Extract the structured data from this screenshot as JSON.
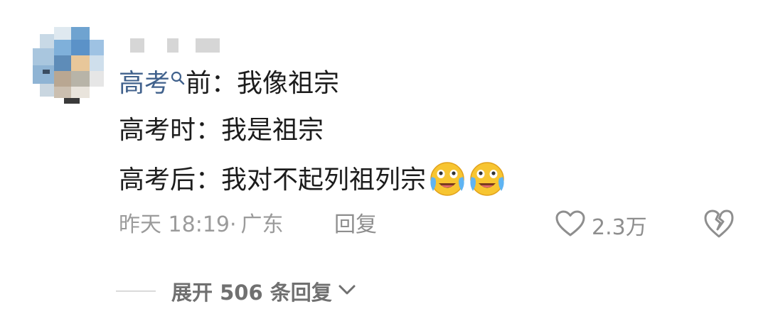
{
  "comment": {
    "topic_link": "高考",
    "line1_rest": "前：我像祖宗",
    "line2": "高考时：我是祖宗",
    "line3": "高考后：我对不起列祖列宗",
    "emojis": [
      "crying-laughing-emoji",
      "crying-laughing-emoji"
    ],
    "time": "昨天 18:19",
    "separator": "·",
    "location": "广东",
    "reply_label": "回复",
    "like_count": "2.3万"
  },
  "replies": {
    "expand_label": "展开 506 条回复"
  },
  "colors": {
    "topic_link": "#40618c",
    "meta": "#9b9b9b",
    "icon": "#8e8e8e"
  }
}
